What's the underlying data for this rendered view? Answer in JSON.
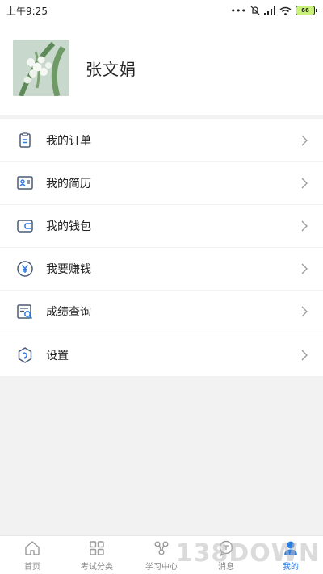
{
  "status_bar": {
    "time": "上午9:25",
    "battery": "66"
  },
  "profile": {
    "name": "张文娟"
  },
  "menu": {
    "items": [
      {
        "label": "我的订单",
        "icon": "order-icon"
      },
      {
        "label": "我的简历",
        "icon": "resume-icon"
      },
      {
        "label": "我的钱包",
        "icon": "wallet-icon"
      },
      {
        "label": "我要赚钱",
        "icon": "yuan-coin-icon"
      },
      {
        "label": "成绩查询",
        "icon": "score-search-icon"
      },
      {
        "label": "设置",
        "icon": "settings-icon"
      }
    ]
  },
  "tab_bar": {
    "tabs": [
      {
        "label": "首页",
        "icon": "home-icon"
      },
      {
        "label": "考试分类",
        "icon": "category-grid-icon"
      },
      {
        "label": "学习中心",
        "icon": "learning-center-icon"
      },
      {
        "label": "消息",
        "icon": "message-icon"
      },
      {
        "label": "我的",
        "icon": "user-icon",
        "active": true
      }
    ]
  },
  "watermark": "138DOWN",
  "colors": {
    "accent": "#2a7be4",
    "icon_stroke": "#4a5a75",
    "background": "#f2f2f2"
  }
}
